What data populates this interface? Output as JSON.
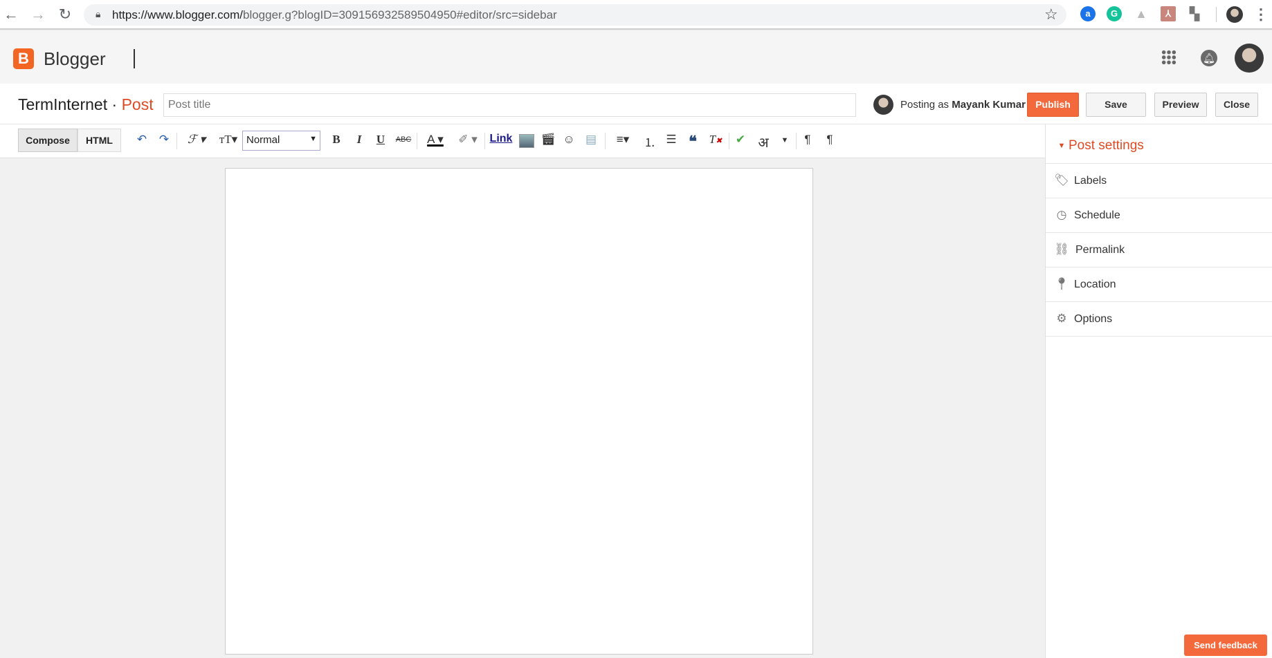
{
  "browser": {
    "url_host": "https://www.blogger.com/",
    "url_path": "blogger.g?blogID=309156932589504950#editor/src=sidebar"
  },
  "header": {
    "brand": "Blogger"
  },
  "post": {
    "blog_name": "TermInternet",
    "separator": "·",
    "section": "Post",
    "title_placeholder": "Post title",
    "title_value": "",
    "posting_as_prefix": "Posting as",
    "author": "Mayank Kumar",
    "publish": "Publish",
    "save": "Save",
    "preview": "Preview",
    "close": "Close"
  },
  "toolbar": {
    "compose": "Compose",
    "html": "HTML",
    "format": "Normal",
    "link": "Link"
  },
  "sidebar": {
    "title": "Post settings",
    "items": [
      {
        "label": "Labels",
        "icon": "tag-icon"
      },
      {
        "label": "Schedule",
        "icon": "clock-icon"
      },
      {
        "label": "Permalink",
        "icon": "link-icon"
      },
      {
        "label": "Location",
        "icon": "location-pin-icon"
      },
      {
        "label": "Options",
        "icon": "gear-icon"
      }
    ]
  },
  "feedback": "Send feedback",
  "colors": {
    "accent": "#f26522",
    "publish": "#f4693b"
  }
}
